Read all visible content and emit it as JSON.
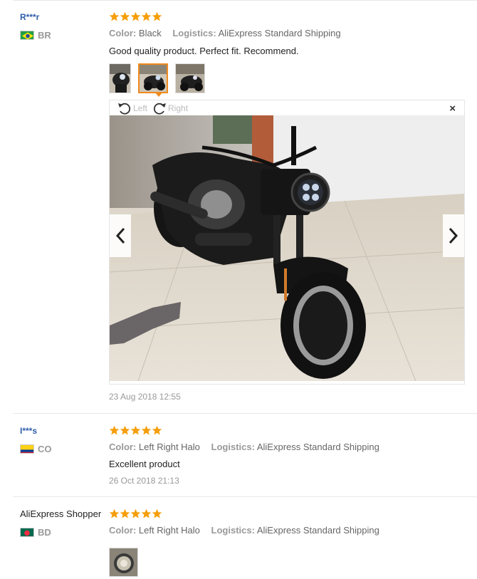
{
  "reviews": [
    {
      "user": "R***r",
      "country_code": "BR",
      "rating": 5,
      "color_label": "Color:",
      "color_value": "Black",
      "logistics_label": "Logistics:",
      "logistics_value": "AliExpress Standard Shipping",
      "text": "Good quality product. Perfect fit. Recommend.",
      "date": "23 Aug 2018 12:55",
      "photos": 3,
      "viewer": {
        "rotate_left": "Left",
        "rotate_right": "Right",
        "close": "×"
      }
    },
    {
      "user": "I***s",
      "country_code": "CO",
      "rating": 5,
      "color_label": "Color:",
      "color_value": "Left Right Halo",
      "logistics_label": "Logistics:",
      "logistics_value": "AliExpress Standard Shipping",
      "text": "Excellent product",
      "date": "26 Oct 2018 21:13"
    },
    {
      "user": "AliExpress Shopper",
      "country_code": "BD",
      "rating": 5,
      "color_label": "Color:",
      "color_value": "Left Right Halo",
      "logistics_label": "Logistics:",
      "logistics_value": "AliExpress Standard Shipping",
      "photos": 1
    }
  ],
  "colors": {
    "star": "#f59e0b",
    "accent": "#f08a1d",
    "user_link": "#2f5eaa"
  }
}
